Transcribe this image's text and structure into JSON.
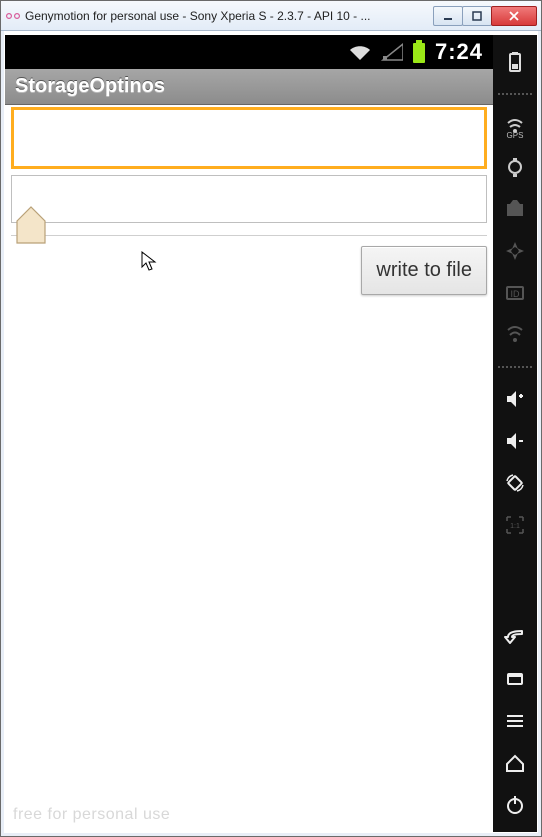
{
  "window": {
    "title": "Genymotion for personal use - Sony Xperia S - 2.3.7 - API 10 - ..."
  },
  "statusbar": {
    "clock": "7:24"
  },
  "app": {
    "title": "StorageOptinos",
    "input1_value": "",
    "input2_value": "",
    "button_label": "write to file",
    "watermark": "free for personal use"
  },
  "sidebar": {
    "gps_label": "GPS",
    "id_label": "ID"
  }
}
